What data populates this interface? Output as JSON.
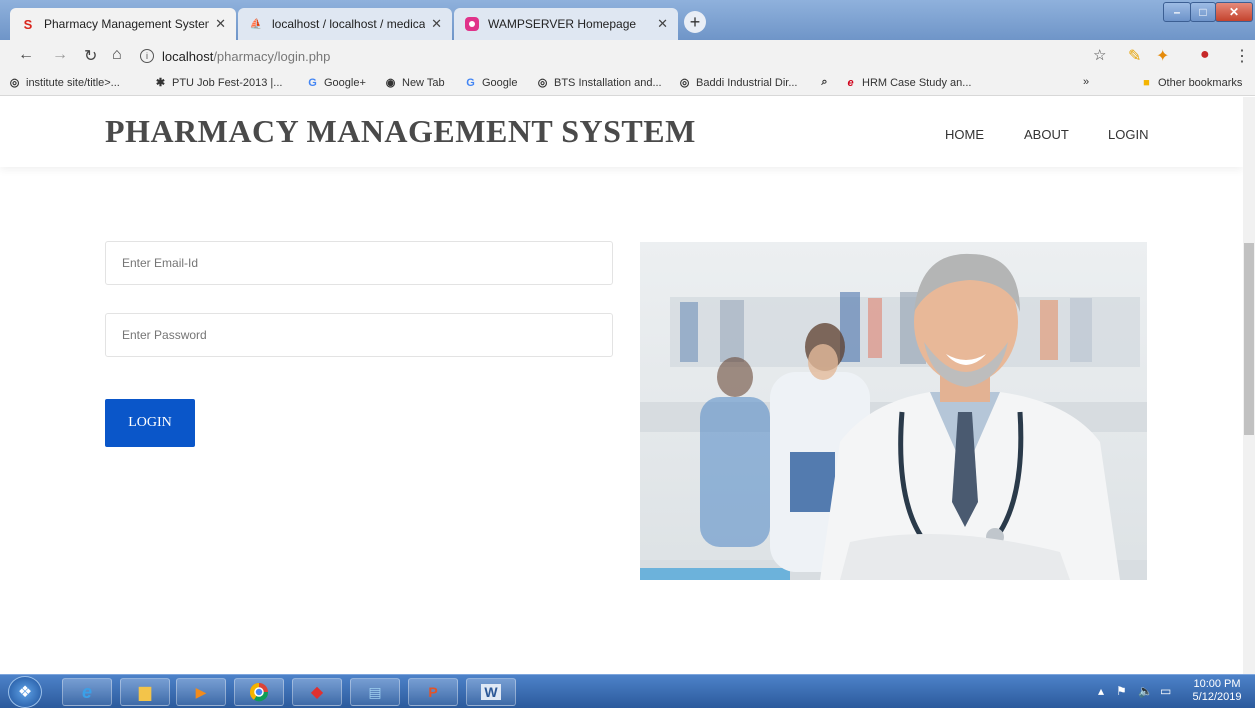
{
  "browser": {
    "tabs": [
      {
        "title": "Pharmacy Management System",
        "icon": "s-logo-icon",
        "color": "#d9251c"
      },
      {
        "title": "localhost / localhost / medical / |",
        "icon": "phpmyadmin-icon",
        "color": "#e8a000"
      },
      {
        "title": "WAMPSERVER Homepage",
        "icon": "wamp-icon",
        "color": "#e0338a"
      }
    ],
    "url_host": "localhost",
    "url_path": "/pharmacy/login.php",
    "bookmarks": [
      "institute site/title>...",
      "PTU Job Fest-2013 |...",
      "Google+",
      "New Tab",
      "Google",
      "BTS Installation and...",
      "Baddi Industrial Dir...",
      "HRM Case Study an..."
    ],
    "overflow_label": "»",
    "other_bookmarks": "Other bookmarks"
  },
  "site": {
    "brand": "PHARMACY MANAGEMENT SYSTEM",
    "nav": [
      "HOME",
      "ABOUT",
      "LOGIN"
    ]
  },
  "login": {
    "email_placeholder": "Enter Email-Id",
    "password_placeholder": "Enter Password",
    "button_label": "LOGIN",
    "button_color": "#0a56c9"
  },
  "taskbar": {
    "time": "10:00 PM",
    "date": "5/12/2019"
  }
}
